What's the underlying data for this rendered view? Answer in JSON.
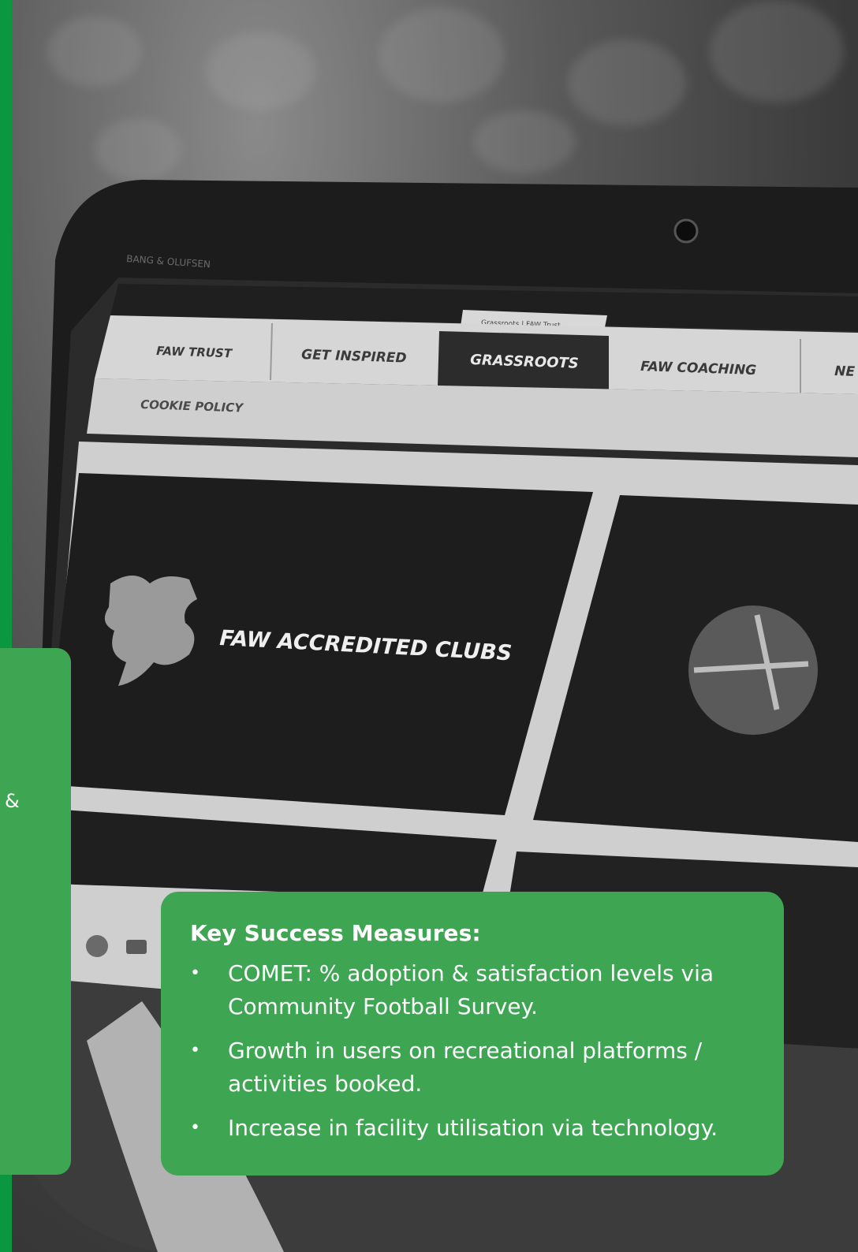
{
  "photo": {
    "tabs": [
      "FAW TRUST",
      "GET INSPIRED",
      "GRASSROOTS",
      "FAW COACHING",
      "NE"
    ],
    "browser_tab_title": "Grassroots | FAW Trust",
    "cookie_label": "COOKIE POLICY",
    "brand_label": "BANG & OLUFSEN",
    "tile_title": "FAW ACCREDITED CLUBS"
  },
  "left_card": {
    "fragment": "&"
  },
  "measures": {
    "heading": "Key Success Measures:",
    "items": [
      {
        "text": "COMET: % adoption & satisfaction levels via Community Football Survey."
      },
      {
        "text": "Growth in users on recreational platforms / activities booked."
      },
      {
        "text": "Increase in facility utilisation via technology."
      }
    ]
  },
  "colors": {
    "brand_green": "#0b9640",
    "card_green": "#3ea653",
    "text_white": "#ffffff"
  }
}
